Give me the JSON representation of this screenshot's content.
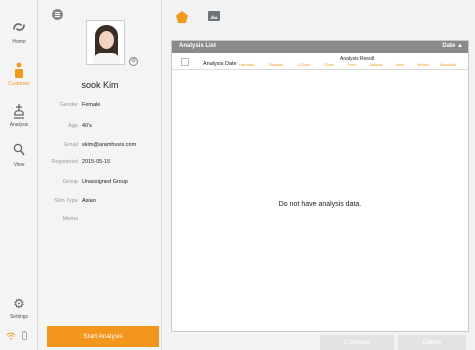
{
  "nav": {
    "items": [
      {
        "label": "Home",
        "icon": "swirl-icon"
      },
      {
        "label": "Customer",
        "icon": "person-icon"
      },
      {
        "label": "Analysis",
        "icon": "analysis-icon"
      },
      {
        "label": "View",
        "icon": "magnifier-icon"
      },
      {
        "label": "Settings",
        "icon": "gear-icon"
      }
    ],
    "active": "Customer",
    "status_icons": [
      "wifi-icon",
      "battery-icon"
    ]
  },
  "customer": {
    "name": "sook Kim",
    "fields": [
      {
        "label": "Gender",
        "value": "Female"
      },
      {
        "label": "Age",
        "value": "40's"
      },
      {
        "label": "Email",
        "value": "skim@aramhuvis.com"
      },
      {
        "label": "Registered",
        "value": "2015-05-15"
      },
      {
        "label": "Group",
        "value": "Unassigned Group"
      },
      {
        "label": "Skin Type",
        "value": "Asian"
      },
      {
        "label": "Memo",
        "value": ""
      }
    ],
    "start_label": "Start Analysis"
  },
  "analysis": {
    "title": "Analysis List",
    "sort_label": "Date ▲",
    "date_column": "Analysis Date",
    "result_column": "Analysis Result",
    "metrics": [
      "Hydration",
      "Elasticity",
      "U.Zone",
      "T.Zone",
      "Pore",
      "Melanin",
      "Acne",
      "Wrinkle",
      "Sensitivity"
    ],
    "empty_message": "Do not have analysis data."
  },
  "actions": {
    "compare": "Compare",
    "delete": "Delete"
  },
  "colors": {
    "accent": "#f29a1c",
    "header": "#8a8a8a",
    "button_disabled": "#e3e3e3"
  }
}
